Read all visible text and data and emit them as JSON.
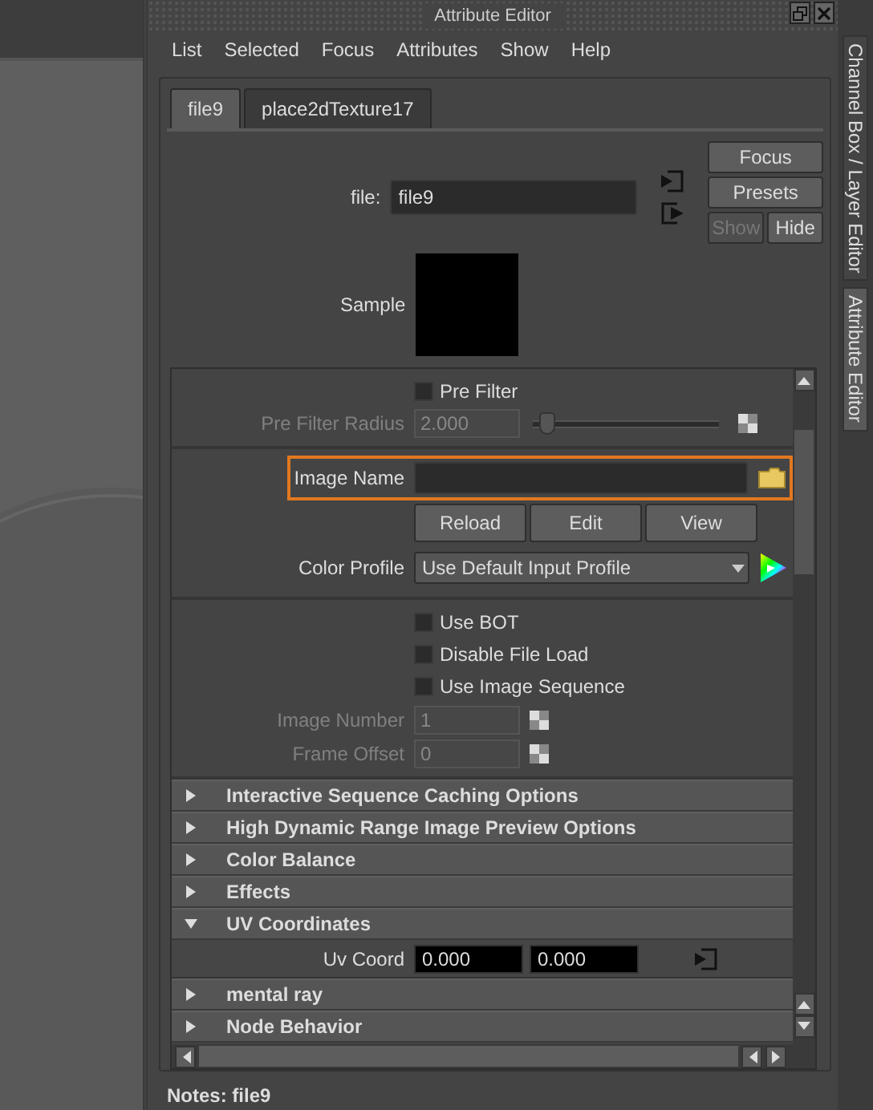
{
  "window": {
    "title": "Attribute Editor"
  },
  "menu": [
    "List",
    "Selected",
    "Focus",
    "Attributes",
    "Show",
    "Help"
  ],
  "tabs": [
    {
      "label": "file9",
      "selected": true
    },
    {
      "label": "place2dTexture17",
      "selected": false
    }
  ],
  "node": {
    "label": "file:",
    "value": "file9"
  },
  "side_buttons": [
    {
      "label": "Focus",
      "disabled": false
    },
    {
      "label": "Presets",
      "disabled": false
    },
    {
      "label": "Show",
      "disabled": true
    },
    {
      "label": "Hide",
      "disabled": false
    }
  ],
  "sample": {
    "label": "Sample"
  },
  "groups": [
    [
      {
        "kind": "checkbox",
        "label": "Pre Filter",
        "checked": false
      },
      {
        "kind": "slider",
        "label": "Pre Filter Radius",
        "value": "2.000",
        "level": 0.08,
        "disabled": true
      }
    ],
    [
      {
        "kind": "file",
        "label": "Image Name",
        "highlighted": true
      },
      {
        "kind": "buttons",
        "labels": [
          "Reload",
          "Edit",
          "View"
        ]
      },
      {
        "kind": "dropdown",
        "label": "Color Profile",
        "value": "Use Default Input Profile"
      }
    ],
    [
      {
        "kind": "checkbox",
        "label": "Use BOT",
        "checked": false
      },
      {
        "kind": "checkbox",
        "label": "Disable File Load",
        "checked": false
      },
      {
        "kind": "checkbox",
        "label": "Use Image Sequence",
        "checked": false
      },
      {
        "kind": "number",
        "label": "Image Number",
        "value": "1",
        "disabled": true
      },
      {
        "kind": "number",
        "label": "Frame Offset",
        "value": "0",
        "disabled": true
      }
    ]
  ],
  "sections": [
    {
      "title": "Interactive Sequence Caching Options",
      "expanded": false
    },
    {
      "title": "High Dynamic Range Image Preview Options",
      "expanded": false
    },
    {
      "title": "Color Balance",
      "expanded": false
    },
    {
      "title": "Effects",
      "expanded": false
    },
    {
      "title": "UV Coordinates",
      "expanded": true,
      "fields": [
        {
          "label": "Uv Coord",
          "values": [
            "0.000",
            "0.000"
          ]
        }
      ]
    },
    {
      "title": "mental ray",
      "expanded": false
    },
    {
      "title": "Node Behavior",
      "expanded": false
    }
  ],
  "notes": "Notes:  file9",
  "side_tabs": [
    {
      "label": "Channel Box / Layer Editor",
      "selected": false
    },
    {
      "label": "Attribute Editor",
      "selected": true
    }
  ]
}
